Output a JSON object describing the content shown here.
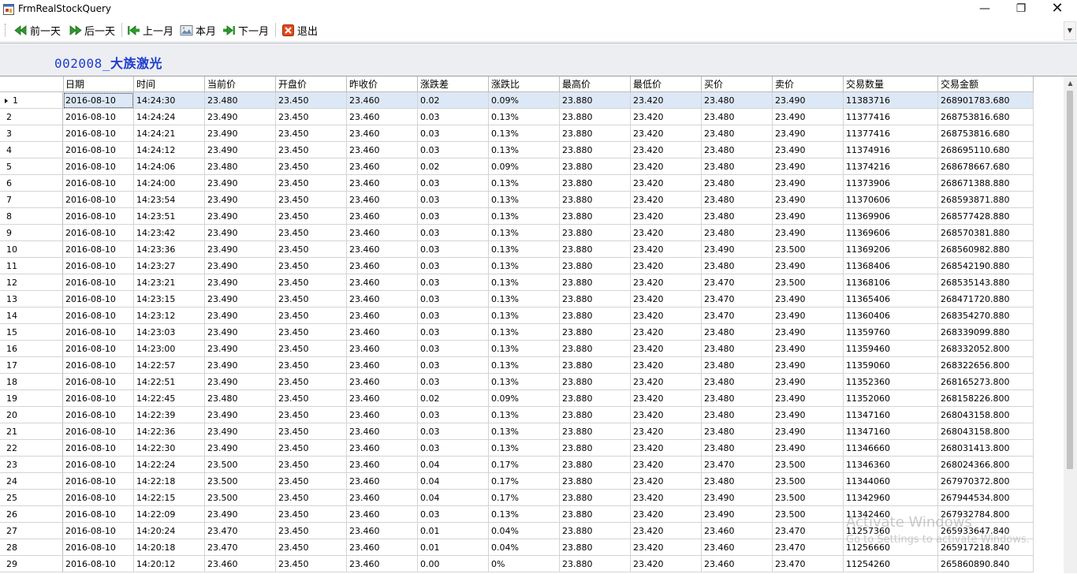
{
  "window": {
    "title": "FrmRealStockQuery",
    "min_label": "—",
    "max_label": "❐",
    "close_label": "✕"
  },
  "toolbar": {
    "prev_day": "前一天",
    "next_day": "后一天",
    "prev_month": "上一月",
    "this_month": "本月",
    "next_month": "下一月",
    "exit": "退出",
    "overflow": "▼"
  },
  "stock": {
    "code": "002008_",
    "name": "大族激光"
  },
  "grid": {
    "columns": [
      "日期",
      "时间",
      "当前价",
      "开盘价",
      "昨收价",
      "涨跌差",
      "涨跌比",
      "最高价",
      "最低价",
      "买价",
      "卖价",
      "交易数量",
      "交易金额"
    ],
    "rows": [
      [
        "1",
        "2016-08-10",
        "14:24:30",
        "23.480",
        "23.450",
        "23.460",
        "0.02",
        "0.09%",
        "23.880",
        "23.420",
        "23.480",
        "23.490",
        "11383716",
        "268901783.680"
      ],
      [
        "2",
        "2016-08-10",
        "14:24:24",
        "23.490",
        "23.450",
        "23.460",
        "0.03",
        "0.13%",
        "23.880",
        "23.420",
        "23.480",
        "23.490",
        "11377416",
        "268753816.680"
      ],
      [
        "3",
        "2016-08-10",
        "14:24:21",
        "23.490",
        "23.450",
        "23.460",
        "0.03",
        "0.13%",
        "23.880",
        "23.420",
        "23.480",
        "23.490",
        "11377416",
        "268753816.680"
      ],
      [
        "4",
        "2016-08-10",
        "14:24:12",
        "23.490",
        "23.450",
        "23.460",
        "0.03",
        "0.13%",
        "23.880",
        "23.420",
        "23.480",
        "23.490",
        "11374916",
        "268695110.680"
      ],
      [
        "5",
        "2016-08-10",
        "14:24:06",
        "23.480",
        "23.450",
        "23.460",
        "0.02",
        "0.09%",
        "23.880",
        "23.420",
        "23.480",
        "23.490",
        "11374216",
        "268678667.680"
      ],
      [
        "6",
        "2016-08-10",
        "14:24:00",
        "23.490",
        "23.450",
        "23.460",
        "0.03",
        "0.13%",
        "23.880",
        "23.420",
        "23.480",
        "23.490",
        "11373906",
        "268671388.880"
      ],
      [
        "7",
        "2016-08-10",
        "14:23:54",
        "23.490",
        "23.450",
        "23.460",
        "0.03",
        "0.13%",
        "23.880",
        "23.420",
        "23.480",
        "23.490",
        "11370606",
        "268593871.880"
      ],
      [
        "8",
        "2016-08-10",
        "14:23:51",
        "23.490",
        "23.450",
        "23.460",
        "0.03",
        "0.13%",
        "23.880",
        "23.420",
        "23.480",
        "23.490",
        "11369906",
        "268577428.880"
      ],
      [
        "9",
        "2016-08-10",
        "14:23:42",
        "23.490",
        "23.450",
        "23.460",
        "0.03",
        "0.13%",
        "23.880",
        "23.420",
        "23.480",
        "23.490",
        "11369606",
        "268570381.880"
      ],
      [
        "10",
        "2016-08-10",
        "14:23:36",
        "23.490",
        "23.450",
        "23.460",
        "0.03",
        "0.13%",
        "23.880",
        "23.420",
        "23.490",
        "23.500",
        "11369206",
        "268560982.880"
      ],
      [
        "11",
        "2016-08-10",
        "14:23:27",
        "23.490",
        "23.450",
        "23.460",
        "0.03",
        "0.13%",
        "23.880",
        "23.420",
        "23.480",
        "23.490",
        "11368406",
        "268542190.880"
      ],
      [
        "12",
        "2016-08-10",
        "14:23:21",
        "23.490",
        "23.450",
        "23.460",
        "0.03",
        "0.13%",
        "23.880",
        "23.420",
        "23.470",
        "23.500",
        "11368106",
        "268535143.880"
      ],
      [
        "13",
        "2016-08-10",
        "14:23:15",
        "23.490",
        "23.450",
        "23.460",
        "0.03",
        "0.13%",
        "23.880",
        "23.420",
        "23.470",
        "23.490",
        "11365406",
        "268471720.880"
      ],
      [
        "14",
        "2016-08-10",
        "14:23:12",
        "23.490",
        "23.450",
        "23.460",
        "0.03",
        "0.13%",
        "23.880",
        "23.420",
        "23.470",
        "23.490",
        "11360406",
        "268354270.880"
      ],
      [
        "15",
        "2016-08-10",
        "14:23:03",
        "23.490",
        "23.450",
        "23.460",
        "0.03",
        "0.13%",
        "23.880",
        "23.420",
        "23.480",
        "23.490",
        "11359760",
        "268339099.880"
      ],
      [
        "16",
        "2016-08-10",
        "14:23:00",
        "23.490",
        "23.450",
        "23.460",
        "0.03",
        "0.13%",
        "23.880",
        "23.420",
        "23.480",
        "23.490",
        "11359460",
        "268332052.800"
      ],
      [
        "17",
        "2016-08-10",
        "14:22:57",
        "23.490",
        "23.450",
        "23.460",
        "0.03",
        "0.13%",
        "23.880",
        "23.420",
        "23.480",
        "23.490",
        "11359060",
        "268322656.800"
      ],
      [
        "18",
        "2016-08-10",
        "14:22:51",
        "23.490",
        "23.450",
        "23.460",
        "0.03",
        "0.13%",
        "23.880",
        "23.420",
        "23.480",
        "23.490",
        "11352360",
        "268165273.800"
      ],
      [
        "19",
        "2016-08-10",
        "14:22:45",
        "23.480",
        "23.450",
        "23.460",
        "0.02",
        "0.09%",
        "23.880",
        "23.420",
        "23.480",
        "23.490",
        "11352060",
        "268158226.800"
      ],
      [
        "20",
        "2016-08-10",
        "14:22:39",
        "23.490",
        "23.450",
        "23.460",
        "0.03",
        "0.13%",
        "23.880",
        "23.420",
        "23.480",
        "23.490",
        "11347160",
        "268043158.800"
      ],
      [
        "21",
        "2016-08-10",
        "14:22:36",
        "23.490",
        "23.450",
        "23.460",
        "0.03",
        "0.13%",
        "23.880",
        "23.420",
        "23.480",
        "23.490",
        "11347160",
        "268043158.800"
      ],
      [
        "22",
        "2016-08-10",
        "14:22:30",
        "23.490",
        "23.450",
        "23.460",
        "0.03",
        "0.13%",
        "23.880",
        "23.420",
        "23.480",
        "23.490",
        "11346660",
        "268031413.800"
      ],
      [
        "23",
        "2016-08-10",
        "14:22:24",
        "23.500",
        "23.450",
        "23.460",
        "0.04",
        "0.17%",
        "23.880",
        "23.420",
        "23.470",
        "23.500",
        "11346360",
        "268024366.800"
      ],
      [
        "24",
        "2016-08-10",
        "14:22:18",
        "23.500",
        "23.450",
        "23.460",
        "0.04",
        "0.17%",
        "23.880",
        "23.420",
        "23.480",
        "23.500",
        "11344060",
        "267970372.800"
      ],
      [
        "25",
        "2016-08-10",
        "14:22:15",
        "23.500",
        "23.450",
        "23.460",
        "0.04",
        "0.17%",
        "23.880",
        "23.420",
        "23.490",
        "23.500",
        "11342960",
        "267944534.800"
      ],
      [
        "26",
        "2016-08-10",
        "14:22:09",
        "23.490",
        "23.450",
        "23.460",
        "0.03",
        "0.13%",
        "23.880",
        "23.420",
        "23.490",
        "23.500",
        "11342460",
        "267932784.800"
      ],
      [
        "27",
        "2016-08-10",
        "14:20:24",
        "23.470",
        "23.450",
        "23.460",
        "0.01",
        "0.04%",
        "23.880",
        "23.420",
        "23.460",
        "23.470",
        "11257360",
        "265933647.840"
      ],
      [
        "28",
        "2016-08-10",
        "14:20:18",
        "23.470",
        "23.450",
        "23.460",
        "0.01",
        "0.04%",
        "23.880",
        "23.420",
        "23.460",
        "23.470",
        "11256660",
        "265917218.840"
      ],
      [
        "29",
        "2016-08-10",
        "14:20:12",
        "23.460",
        "23.450",
        "23.460",
        "0.00",
        "0%",
        "23.880",
        "23.420",
        "23.460",
        "23.470",
        "11254260",
        "265860890.840"
      ]
    ]
  },
  "watermark": {
    "line1": "Activate Windows",
    "line2": "Go to Settings to activate Windows."
  }
}
